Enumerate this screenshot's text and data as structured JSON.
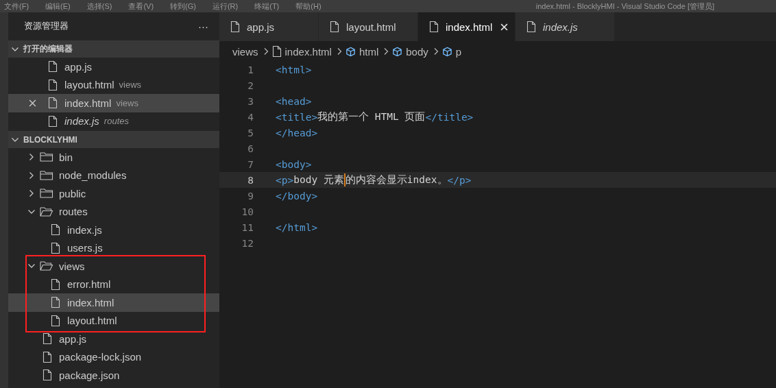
{
  "menu_bar": {
    "items": [
      "文件(F)",
      "编辑(E)",
      "选择(S)",
      "查看(V)",
      "转到(G)",
      "运行(R)",
      "终端(T)",
      "帮助(H)"
    ],
    "title": "index.html - BlocklyHMI - Visual Studio Code [管理员]"
  },
  "sidebar": {
    "title": "资源管理器",
    "more": "···",
    "open_editors": {
      "title": "打开的编辑器",
      "expanded": true,
      "items": [
        {
          "name": "app.js",
          "preview": false,
          "selected": false
        },
        {
          "name": "layout.html",
          "description": "views",
          "preview": false,
          "selected": false
        },
        {
          "name": "index.html",
          "description": "views",
          "preview": false,
          "selected": true
        },
        {
          "name": "index.js",
          "description": "routes",
          "preview": true,
          "selected": false
        }
      ]
    },
    "project": {
      "title": "BLOCKLYHMI",
      "expanded": true,
      "items": [
        {
          "kind": "folder",
          "name": "bin",
          "expanded": false,
          "selected": false
        },
        {
          "kind": "folder",
          "name": "node_modules",
          "expanded": false,
          "selected": false
        },
        {
          "kind": "folder",
          "name": "public",
          "expanded": false,
          "selected": false
        },
        {
          "kind": "folder",
          "name": "routes",
          "expanded": true,
          "selected": false,
          "children": [
            {
              "kind": "file",
              "name": "index.js",
              "selected": false
            },
            {
              "kind": "file",
              "name": "users.js",
              "selected": false
            }
          ]
        },
        {
          "kind": "folder",
          "name": "views",
          "expanded": true,
          "highlighted": true,
          "selected": false,
          "children": [
            {
              "kind": "file",
              "name": "error.html",
              "selected": false
            },
            {
              "kind": "file",
              "name": "index.html",
              "selected": true
            },
            {
              "kind": "file",
              "name": "layout.html",
              "selected": false
            }
          ]
        },
        {
          "kind": "file",
          "name": "app.js",
          "selected": false
        },
        {
          "kind": "file",
          "name": "package-lock.json",
          "selected": false
        },
        {
          "kind": "file",
          "name": "package.json",
          "selected": false
        }
      ]
    }
  },
  "tabs": [
    {
      "label": "app.js",
      "selected": false,
      "preview": false
    },
    {
      "label": "layout.html",
      "selected": false,
      "preview": false
    },
    {
      "label": "index.html",
      "selected": true,
      "preview": false
    },
    {
      "label": "index.js",
      "selected": false,
      "preview": true
    }
  ],
  "breadcrumb": [
    {
      "kind": "folder",
      "label": "views"
    },
    {
      "kind": "file",
      "label": "index.html"
    },
    {
      "kind": "element",
      "label": "html"
    },
    {
      "kind": "element",
      "label": "body"
    },
    {
      "kind": "element",
      "label": "p"
    }
  ],
  "editor": {
    "lines": [
      {
        "number": "1",
        "current": false,
        "tokens": [
          {
            "kind": "tag",
            "text": "<html>"
          }
        ]
      },
      {
        "number": "2",
        "current": false
      },
      {
        "number": "3",
        "current": false,
        "tokens": [
          {
            "kind": "tag",
            "text": "<head>"
          }
        ]
      },
      {
        "number": "4",
        "current": false,
        "tokens": [
          {
            "kind": "tag",
            "text": "<title>"
          },
          {
            "kind": "text",
            "text": "我的第一个 HTML 页面"
          },
          {
            "kind": "tag",
            "text": "</title>"
          }
        ]
      },
      {
        "number": "5",
        "current": false,
        "tokens": [
          {
            "kind": "tag",
            "text": "</head>"
          }
        ]
      },
      {
        "number": "6",
        "current": false
      },
      {
        "number": "7",
        "current": false,
        "tokens": [
          {
            "kind": "tag",
            "text": "<body>"
          }
        ]
      },
      {
        "number": "8",
        "current": true,
        "tokens": [
          {
            "kind": "tag",
            "text": "<p>"
          },
          {
            "kind": "text",
            "text": "body 元素",
            "cursor_after": true
          },
          {
            "kind": "text",
            "text": "的内容会显示index。"
          },
          {
            "kind": "tag",
            "text": "</p>"
          }
        ]
      },
      {
        "number": "9",
        "current": false,
        "tokens": [
          {
            "kind": "tag",
            "text": "</body>"
          }
        ]
      },
      {
        "number": "10",
        "current": false
      },
      {
        "number": "11",
        "current": false,
        "tokens": [
          {
            "kind": "tag",
            "text": "</html>"
          }
        ]
      },
      {
        "number": "12",
        "current": false
      }
    ]
  }
}
